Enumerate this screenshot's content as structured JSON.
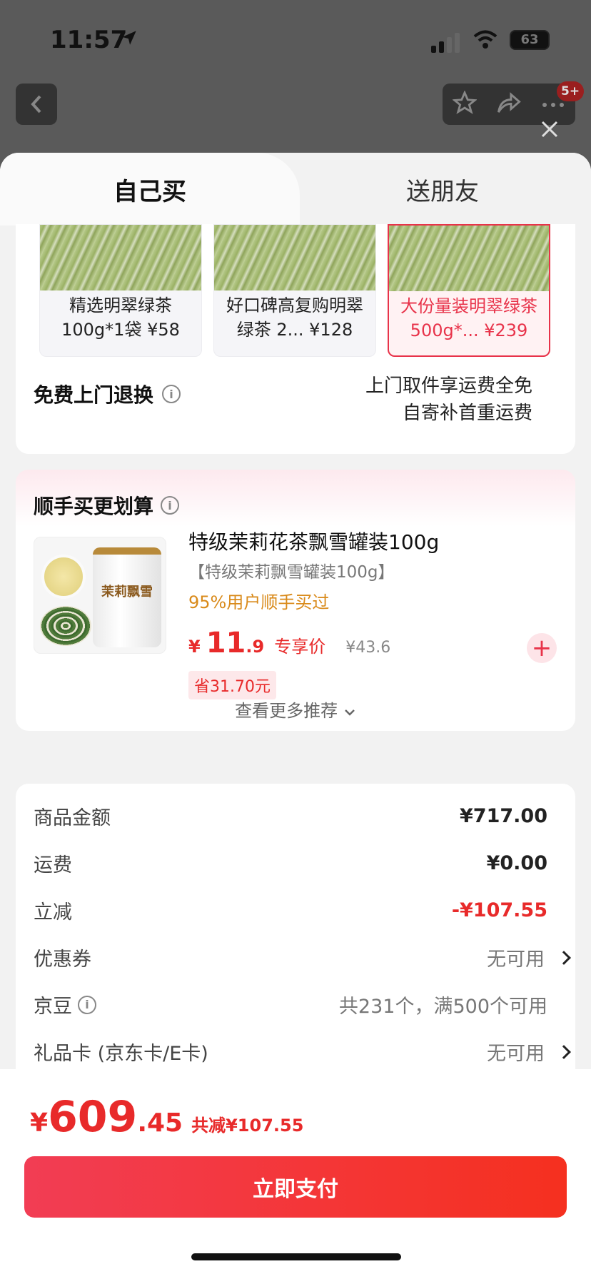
{
  "status_bar": {
    "time": "11:57",
    "battery": "63"
  },
  "header": {
    "badge": "5+"
  },
  "tabs": {
    "self": "自己买",
    "gift": "送朋友"
  },
  "skus": [
    {
      "label": "精选明翠绿茶100g*1袋 ¥58",
      "selected": false
    },
    {
      "label": "好口碑高复购明翠绿茶 2... ¥128",
      "selected": false
    },
    {
      "label": "大份量装明翠绿茶 500g*... ¥239",
      "selected": true
    }
  ],
  "returns": {
    "title": "免费上门退换",
    "line1": "上门取件享运费全免",
    "line2": "自寄补首重运费"
  },
  "addon": {
    "title": "顺手买更划算",
    "product_name": "特级茉莉花茶飘雪罐装100g",
    "spec": "【特级茉莉飘雪罐装100g】",
    "bought": "95%用户顺手买过",
    "price_symbol": "¥",
    "price_int": "11",
    "price_dec": ".9",
    "price_label": "专享价",
    "orig_price": "¥43.6",
    "save": "省31.70元",
    "can_text": "茉莉飘雪",
    "more": "查看更多推荐"
  },
  "summary": {
    "goods_label": "商品金额",
    "goods_value": "¥717.00",
    "ship_label": "运费",
    "ship_value": "¥0.00",
    "discount_label": "立减",
    "discount_value": "-¥107.55",
    "coupon_label": "优惠券",
    "coupon_value": "无可用",
    "jd_label": "京豆",
    "jd_value": "共231个，满500个可用",
    "gift_label": "礼品卡 (京东卡/E卡)",
    "gift_value": "无可用"
  },
  "footer": {
    "symbol": "¥",
    "total_int": "609",
    "total_dec": ".45",
    "saved": "共减¥107.55",
    "pay_label": "立即支付"
  }
}
